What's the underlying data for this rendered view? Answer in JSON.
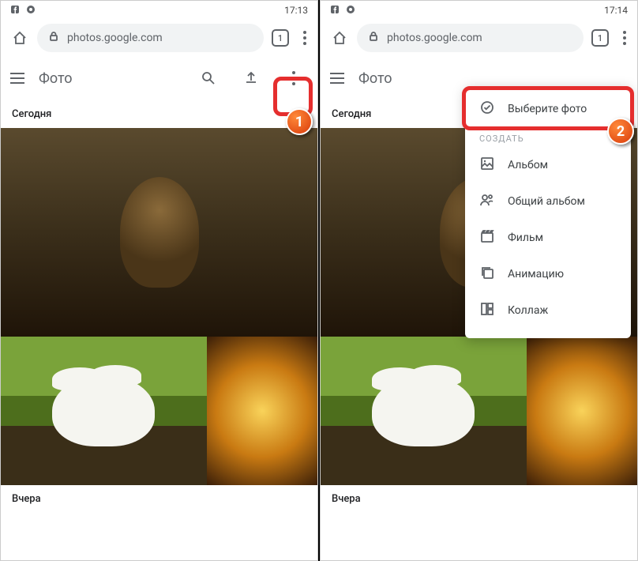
{
  "left": {
    "time": "17:13",
    "url": "photos.google.com",
    "tabs": "1",
    "app_title": "Фото",
    "section_today": "Сегодня",
    "section_yday": "Вчера",
    "annot": "1"
  },
  "right": {
    "time": "17:14",
    "url": "photos.google.com",
    "tabs": "1",
    "app_title": "Фото",
    "section_today": "Сегодня",
    "section_yday": "Вчера",
    "annot": "2",
    "menu": {
      "select": "Выберите фото",
      "create_label": "СОЗДАТЬ",
      "album": "Альбом",
      "shared": "Общий альбом",
      "movie": "Фильм",
      "anim": "Анимацию",
      "collage": "Коллаж"
    }
  }
}
